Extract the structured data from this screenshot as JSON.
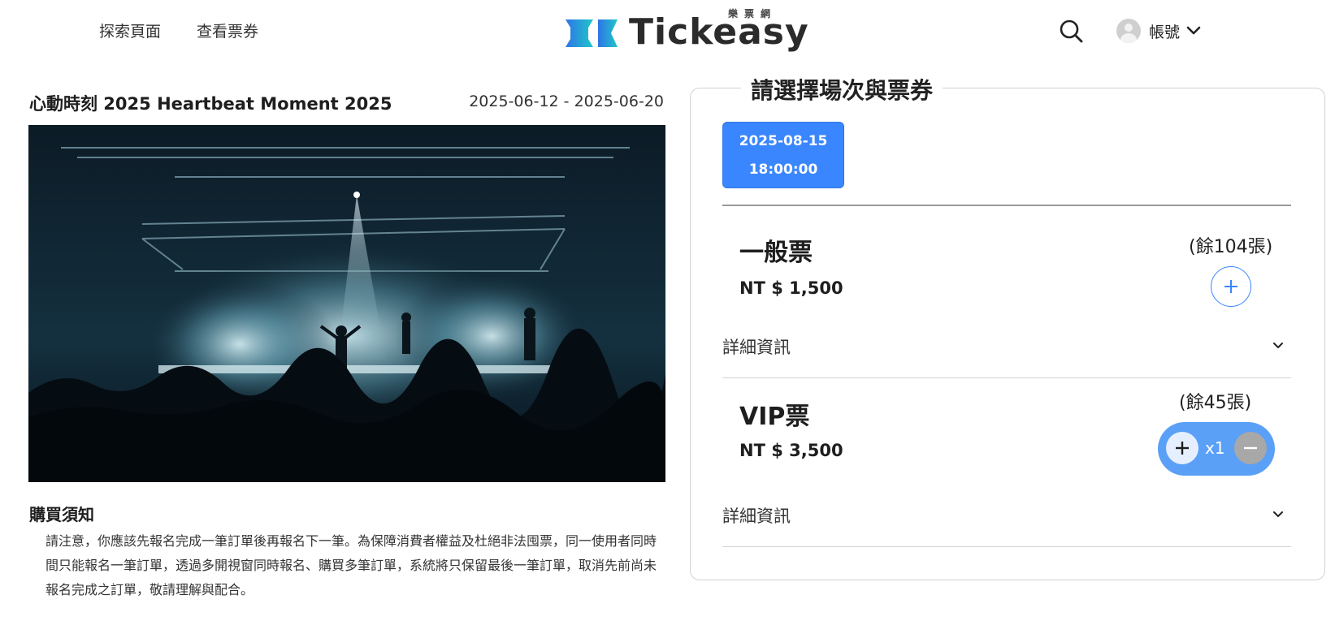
{
  "header": {
    "nav": [
      "探索頁面",
      "查看票券"
    ],
    "logo": {
      "text": "Tickeasy",
      "subtitle": "樂票網"
    },
    "account_label": "帳號"
  },
  "event": {
    "title": "心動時刻 2025 Heartbeat Moment 2025",
    "dates": "2025-06-12 - 2025-06-20",
    "notice_title": "購買須知",
    "notice_body": "請注意，你應該先報名完成一筆訂單後再報名下一筆。為保障消費者權益及杜絕非法囤票，同一使用者同時間只能報名一筆訂單，透過多開視窗同時報名、購買多筆訂單，系統將只保留最後一筆訂單，取消先前尚未報名完成之訂單，敬請理解與配合。"
  },
  "panel": {
    "title": "請選擇場次與票券",
    "session": {
      "date": "2025-08-15",
      "time": "18:00:00"
    },
    "tickets": [
      {
        "name": "一般票",
        "price": "NT $ 1,500",
        "remaining": "(餘104張)",
        "details_label": "詳細資訊"
      },
      {
        "name": "VIP票",
        "price": "NT $ 3,500",
        "remaining": "(餘45張)",
        "details_label": "詳細資訊",
        "quantity": "x1"
      }
    ]
  },
  "colors": {
    "accent": "#3a86ff",
    "pill": "#5aa0f7",
    "logo_teal": "#1fb8c9",
    "logo_blue": "#2f74e6"
  }
}
